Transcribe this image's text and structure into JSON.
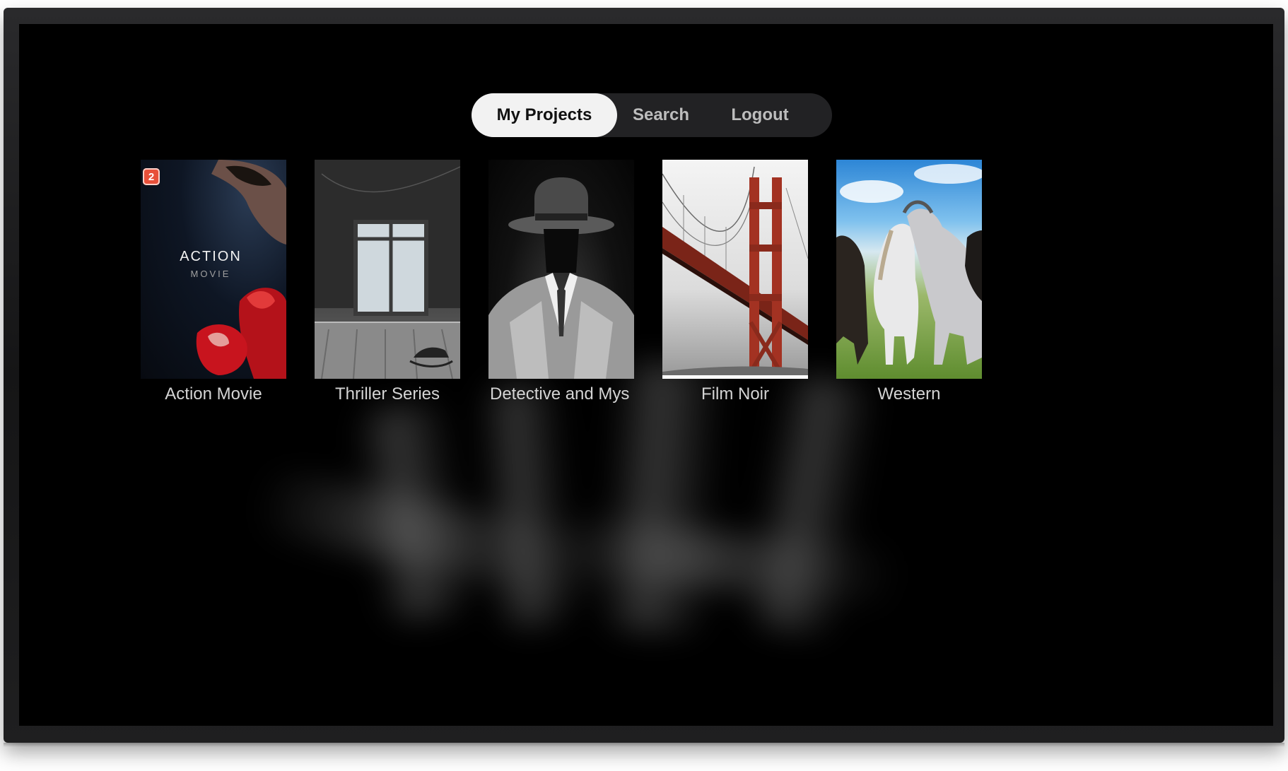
{
  "nav": {
    "tabs": [
      {
        "label": "My Projects",
        "active": true
      },
      {
        "label": "Search",
        "active": false
      },
      {
        "label": "Logout",
        "active": false
      }
    ]
  },
  "projects": [
    {
      "title": "Action Movie",
      "badge": "2",
      "poster_text": "ACTION",
      "poster_subtext": "MOVIE"
    },
    {
      "title": "Thriller Series"
    },
    {
      "title": "Detective and Mys"
    },
    {
      "title": "Film Noir",
      "focused": true
    },
    {
      "title": "Western"
    }
  ],
  "colors": {
    "screen_bg": "#000000",
    "active_tab_bg": "#f2f2f2",
    "nav_bg": "#28282a",
    "label_text": "#d4d4d4",
    "badge": "#e8503a"
  }
}
